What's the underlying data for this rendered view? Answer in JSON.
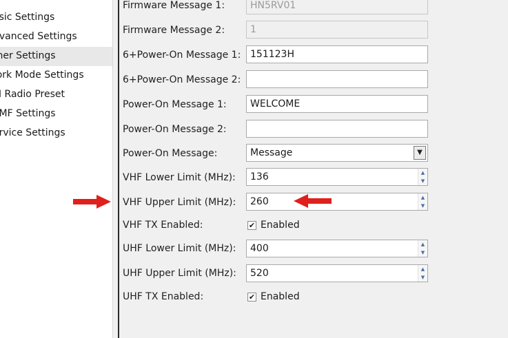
{
  "sidebar": {
    "items": [
      {
        "label": "asic Settings"
      },
      {
        "label": "dvanced Settings"
      },
      {
        "label": "ther Settings",
        "selected": true
      },
      {
        "label": "/ork Mode Settings"
      },
      {
        "label": "M Radio Preset"
      },
      {
        "label": "TMF Settings"
      },
      {
        "label": "ervice Settings"
      }
    ]
  },
  "form": {
    "firmware_message_1": {
      "label": "Firmware Message 1:",
      "value": "HN5RV01"
    },
    "firmware_message_2": {
      "label": "Firmware Message 2:",
      "value": "1"
    },
    "power6_message_1": {
      "label": "6+Power-On Message 1:",
      "value": "151123H"
    },
    "power6_message_2": {
      "label": "6+Power-On Message 2:",
      "value": ""
    },
    "poweron_message_1": {
      "label": "Power-On Message 1:",
      "value": "WELCOME"
    },
    "poweron_message_2": {
      "label": "Power-On Message 2:",
      "value": ""
    },
    "poweron_message": {
      "label": "Power-On Message:",
      "value": "Message"
    },
    "vhf_lower": {
      "label": "VHF Lower Limit (MHz):",
      "value": "136"
    },
    "vhf_upper": {
      "label": "VHF Upper Limit (MHz):",
      "value": "260"
    },
    "vhf_tx": {
      "label": "VHF TX Enabled:",
      "checkbox_label": "Enabled",
      "checked": true
    },
    "uhf_lower": {
      "label": "UHF Lower Limit (MHz):",
      "value": "400"
    },
    "uhf_upper": {
      "label": "UHF Upper Limit (MHz):",
      "value": "520"
    },
    "uhf_tx": {
      "label": "UHF TX Enabled:",
      "checkbox_label": "Enabled",
      "checked": true
    }
  },
  "glyphs": {
    "check": "✔",
    "spin_up": "▲",
    "spin_down": "▼",
    "dropdown": "▼"
  },
  "annotation_color": "#e0201c"
}
